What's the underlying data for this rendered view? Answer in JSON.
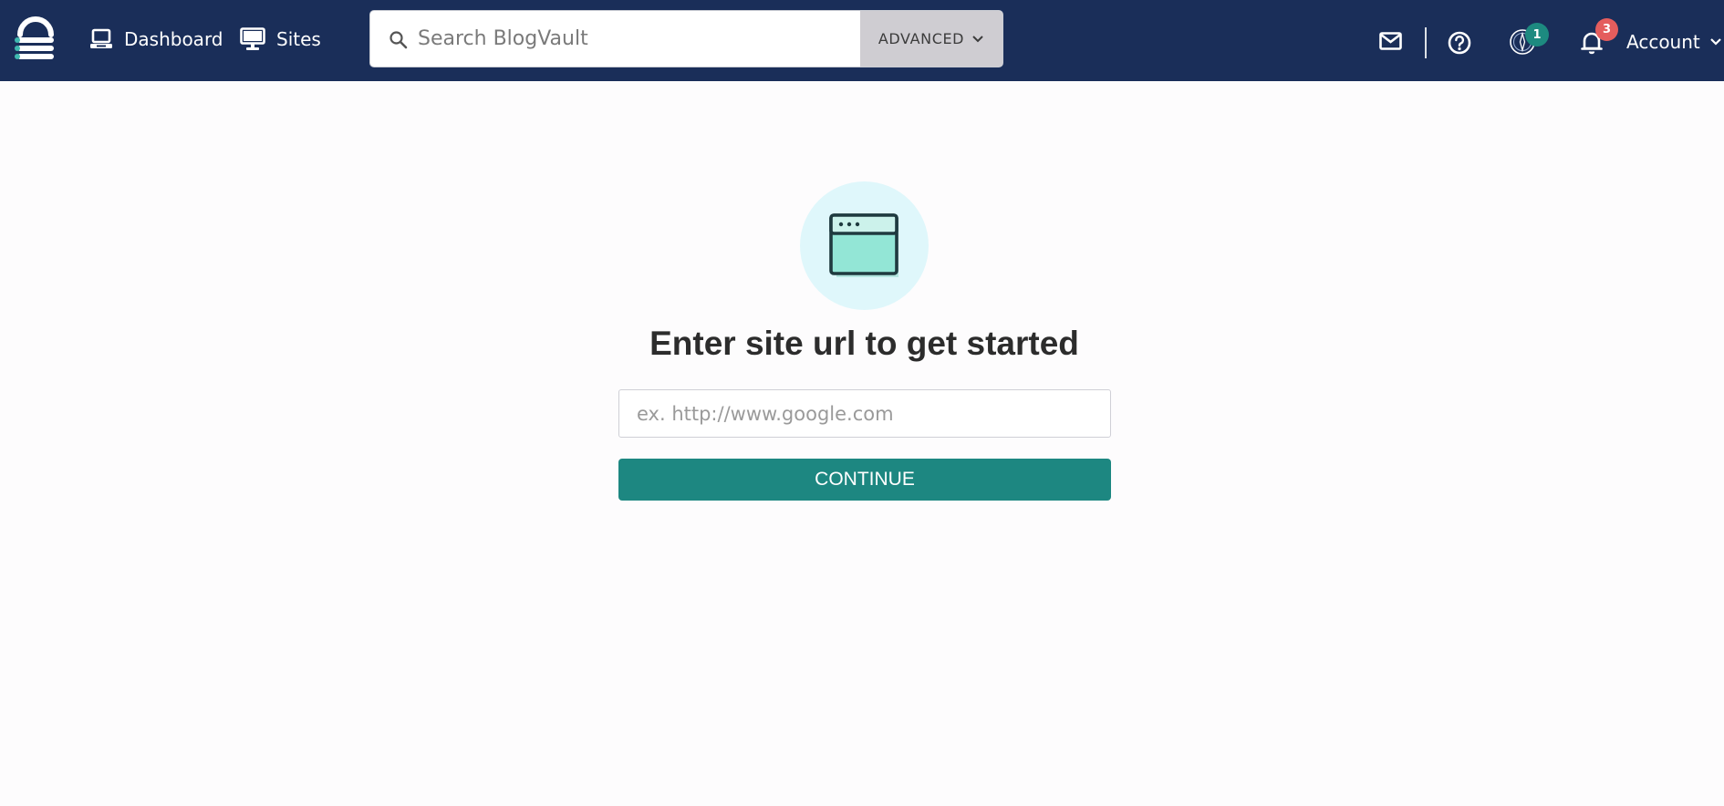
{
  "header": {
    "logo_icon": "blogvault-logo-icon",
    "nav": [
      {
        "label": "Dashboard",
        "icon": "laptop-icon"
      },
      {
        "label": "Sites",
        "icon": "monitor-icon"
      }
    ],
    "search": {
      "placeholder": "Search BlogVault",
      "value": "",
      "advanced_label": "ADVANCED"
    },
    "icons": [
      "mail-icon",
      "help-icon",
      "compass-icon",
      "bell-icon"
    ],
    "compass_badge": "1",
    "notifications_badge": "3",
    "account_label": "Account"
  },
  "main": {
    "icon": "browser-window-icon",
    "headline": "Enter site url to get started",
    "url_input": {
      "placeholder": "ex. http://www.google.com",
      "value": ""
    },
    "continue_label": "CONTINUE"
  },
  "colors": {
    "header_bg": "#1a2e59",
    "accent_teal": "#1d8781",
    "badge_red": "#e45d5d",
    "hero_circle": "#dff7fb"
  }
}
